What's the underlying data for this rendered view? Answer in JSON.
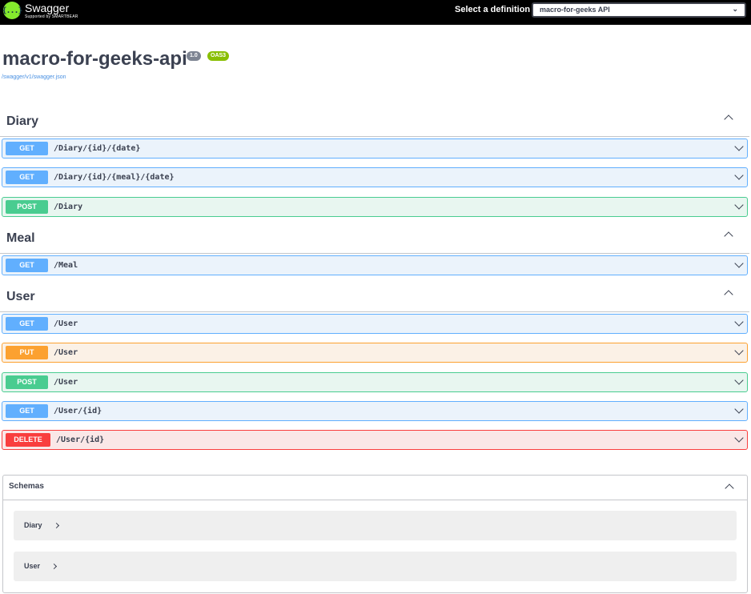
{
  "topbar": {
    "logo_icon": "{...}",
    "logo_name": "Swagger",
    "logo_sub": "Supported by SMARTBEAR",
    "definition_label": "Select a definition",
    "definition_value": "macro-for-geeks API"
  },
  "info": {
    "title": "macro-for-geeks-api",
    "version": "1.0",
    "oas": "OAS3",
    "spec_url": "/swagger/v1/swagger.json"
  },
  "tags": {
    "diary": "Diary",
    "meal": "Meal",
    "user": "User"
  },
  "ops": [
    {
      "method": "GET",
      "path": "/Diary/{id}/{date}"
    },
    {
      "method": "GET",
      "path": "/Diary/{id}/{meal}/{date}"
    },
    {
      "method": "POST",
      "path": "/Diary"
    },
    {
      "method": "GET",
      "path": "/Meal"
    },
    {
      "method": "GET",
      "path": "/User"
    },
    {
      "method": "PUT",
      "path": "/User"
    },
    {
      "method": "POST",
      "path": "/User"
    },
    {
      "method": "GET",
      "path": "/User/{id}"
    },
    {
      "method": "DELETE",
      "path": "/User/{id}"
    }
  ],
  "schemas": {
    "title": "Schemas",
    "models": [
      "Diary",
      "User"
    ]
  },
  "colors": {
    "get": "#61affe",
    "post": "#49cc90",
    "put": "#fca130",
    "delete": "#f93e3e",
    "logo": "#85ea2d"
  }
}
